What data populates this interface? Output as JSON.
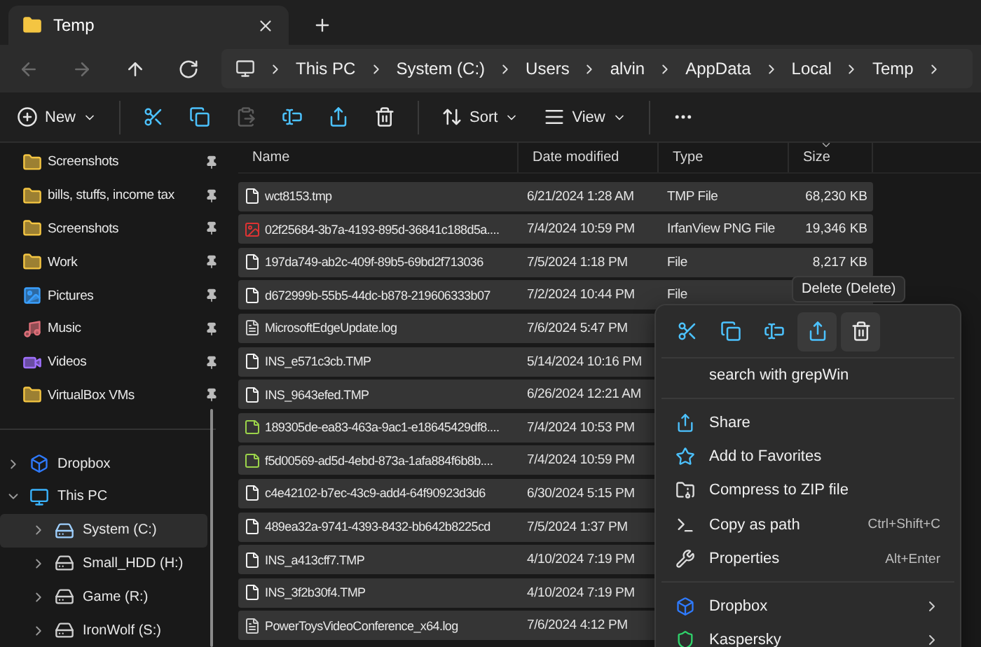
{
  "tabs": [
    {
      "label": "Temp",
      "selected": true
    }
  ],
  "nav": [
    {
      "kind": "back",
      "disabled": true
    },
    {
      "kind": "forward",
      "disabled": true
    },
    {
      "kind": "up",
      "disabled": false
    },
    {
      "kind": "refresh",
      "disabled": false
    }
  ],
  "breadcrumb": [
    "This PC",
    "System (C:)",
    "Users",
    "alvin",
    "AppData",
    "Local",
    "Temp"
  ],
  "toolbar": [
    {
      "kind": "new",
      "label": "New",
      "disabled": false
    },
    {
      "kind": "cut",
      "disabled": false
    },
    {
      "kind": "copy",
      "disabled": false
    },
    {
      "kind": "paste",
      "disabled": true
    },
    {
      "kind": "rename",
      "disabled": false
    },
    {
      "kind": "share",
      "disabled": false
    },
    {
      "kind": "delete",
      "disabled": false
    },
    {
      "kind": "sort",
      "label": "Sort",
      "disabled": false
    },
    {
      "kind": "view",
      "label": "View",
      "disabled": false
    },
    {
      "kind": "more",
      "disabled": false
    }
  ],
  "sidebar": {
    "quick_access": [
      {
        "label": "Screenshots",
        "kind": "folder"
      },
      {
        "label": "bills, stuffs, income tax",
        "kind": "synced-folder"
      },
      {
        "label": "Screenshots",
        "kind": "folder"
      },
      {
        "label": "Work",
        "kind": "folder"
      },
      {
        "label": "Pictures",
        "kind": "pictures"
      },
      {
        "label": "Music",
        "kind": "music"
      },
      {
        "label": "Videos",
        "kind": "videos"
      },
      {
        "label": "VirtualBox VMs",
        "kind": "folder"
      }
    ],
    "tree": [
      {
        "label": "Dropbox",
        "kind": "dropbox",
        "expanded": false,
        "selected": false
      },
      {
        "label": "This PC",
        "kind": "pc",
        "expanded": true,
        "selected": false,
        "children": [
          {
            "label": "System (C:)",
            "kind": "system-drive",
            "expanded": false,
            "selected": true
          },
          {
            "label": "Small_HDD (H:)",
            "kind": "drive",
            "expanded": false,
            "selected": false
          },
          {
            "label": "Game (R:)",
            "kind": "drive",
            "expanded": false,
            "selected": false
          },
          {
            "label": "IronWolf (S:)",
            "kind": "drive",
            "expanded": false,
            "selected": false
          }
        ]
      }
    ]
  },
  "table": {
    "columns": [
      {
        "label": "Name",
        "sorted": false
      },
      {
        "label": "Date modified",
        "sorted": false
      },
      {
        "label": "Type",
        "sorted": false
      },
      {
        "label": "Size",
        "sorted": true
      }
    ],
    "rows": [
      {
        "name": "wct8153.tmp",
        "kind": "file",
        "date": "6/21/2024 1:28 AM",
        "type": "TMP File",
        "size": "68,230 KB",
        "selected": true
      },
      {
        "name": "02f25684-3b7a-4193-895d-36841c188d5a....",
        "kind": "image",
        "date": "7/4/2024 10:59 PM",
        "type": "IrfanView PNG File",
        "size": "19,346 KB",
        "selected": true
      },
      {
        "name": "197da749-ab2c-409f-89b5-69bd2f713036",
        "kind": "file",
        "date": "7/5/2024 1:18 PM",
        "type": "File",
        "size": "8,217 KB",
        "selected": true
      },
      {
        "name": "d672999b-55b5-44dc-b878-219606333b07",
        "kind": "file",
        "date": "7/2/2024 10:44 PM",
        "type": "File",
        "selected": true
      },
      {
        "name": "MicrosoftEdgeUpdate.log",
        "kind": "text",
        "date": "7/6/2024 5:47 PM",
        "selected": true
      },
      {
        "name": "INS_e571c3cb.TMP",
        "kind": "file",
        "date": "5/14/2024 10:16 PM",
        "selected": true
      },
      {
        "name": "INS_9643efed.TMP",
        "kind": "file",
        "date": "6/26/2024 12:21 AM",
        "selected": true
      },
      {
        "name": "189305de-ea83-463a-9ac1-e18645429df8....",
        "kind": "note",
        "date": "7/4/2024 10:53 PM",
        "selected": true
      },
      {
        "name": "f5d00569-ad5d-4ebd-873a-1afa884f6b8b....",
        "kind": "note",
        "date": "7/4/2024 10:59 PM",
        "selected": true
      },
      {
        "name": "c4e42102-b7ec-43c9-add4-64f90923d3d6",
        "kind": "file",
        "date": "6/30/2024 5:15 PM",
        "selected": true
      },
      {
        "name": "489ea32a-9741-4393-8432-bb642b8225cd",
        "kind": "file",
        "date": "7/5/2024 1:37 PM",
        "selected": true
      },
      {
        "name": "INS_a413cff7.TMP",
        "kind": "file",
        "date": "4/10/2024 7:19 PM",
        "selected": true
      },
      {
        "name": "INS_3f2b30f4.TMP",
        "kind": "file",
        "date": "4/10/2024 7:19 PM",
        "selected": true
      },
      {
        "name": "PowerToysVideoConference_x64.log",
        "kind": "text",
        "date": "7/6/2024 4:12 PM",
        "selected": true
      }
    ]
  },
  "context_menu": {
    "icon_row": [
      {
        "kind": "cut",
        "hovered": false
      },
      {
        "kind": "copy",
        "hovered": false
      },
      {
        "kind": "rename",
        "hovered": false
      },
      {
        "kind": "share",
        "hovered": true
      },
      {
        "kind": "delete",
        "hovered": true
      }
    ],
    "tooltip": "Delete (Delete)",
    "groups": [
      [
        {
          "label": "search with grepWin",
          "kind": "plain"
        }
      ],
      [
        {
          "label": "Share",
          "kind": "share"
        },
        {
          "label": "Add to Favorites",
          "kind": "star"
        },
        {
          "label": "Compress to ZIP file",
          "kind": "zip"
        },
        {
          "label": "Copy as path",
          "kind": "path",
          "shortcut": "Ctrl+Shift+C"
        },
        {
          "label": "Properties",
          "kind": "properties",
          "shortcut": "Alt+Enter"
        }
      ],
      [
        {
          "label": "Dropbox",
          "kind": "dropbox",
          "submenu": true
        },
        {
          "label": "Kaspersky",
          "kind": "kaspersky",
          "submenu": true
        }
      ]
    ]
  }
}
